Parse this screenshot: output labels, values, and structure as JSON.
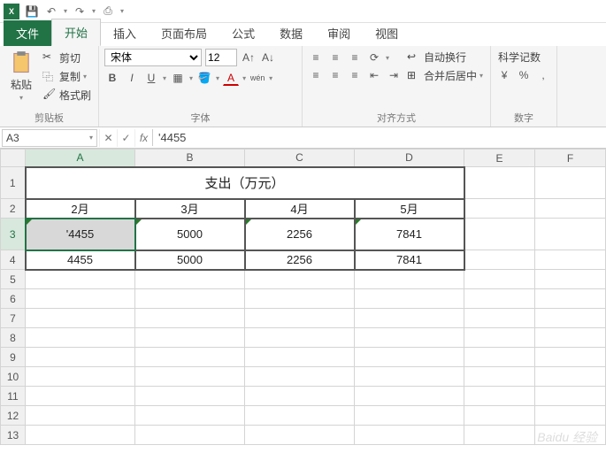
{
  "qat": {
    "excel": "X",
    "save": "💾",
    "undo": "↶",
    "redo": "↷",
    "print": "⎙"
  },
  "tabs": {
    "file": "文件",
    "home": "开始",
    "insert": "插入",
    "layout": "页面布局",
    "formula": "公式",
    "data": "数据",
    "review": "审阅",
    "view": "视图"
  },
  "clipboard": {
    "paste": "粘贴",
    "cut": "剪切",
    "copy": "复制",
    "format": "格式刷",
    "label": "剪贴板"
  },
  "font": {
    "name": "宋体",
    "size": "12",
    "bold": "B",
    "italic": "I",
    "underline": "U",
    "label": "字体",
    "wen": "wén"
  },
  "align": {
    "wrap": "自动换行",
    "merge": "合并后居中",
    "label": "对齐方式"
  },
  "number": {
    "sci": "科学记数",
    "pct": "%",
    "comma": ",",
    "label": "数字"
  },
  "namebox": "A3",
  "formula": "'4455",
  "cols": [
    "A",
    "B",
    "C",
    "D",
    "E",
    "F"
  ],
  "rows": [
    "1",
    "2",
    "3",
    "4",
    "5",
    "6",
    "7",
    "8",
    "9",
    "10",
    "11",
    "12",
    "13"
  ],
  "cells": {
    "title": "支出（万元）",
    "h": [
      "2月",
      "3月",
      "4月",
      "5月"
    ],
    "r3": [
      "'4455",
      "5000",
      "2256",
      "7841"
    ],
    "r4": [
      "4455",
      "5000",
      "2256",
      "7841"
    ]
  },
  "chart_data": {
    "type": "table",
    "title": "支出（万元）",
    "categories": [
      "2月",
      "3月",
      "4月",
      "5月"
    ],
    "series": [
      {
        "name": "row3",
        "values": [
          4455,
          5000,
          2256,
          7841
        ]
      },
      {
        "name": "row4",
        "values": [
          4455,
          5000,
          2256,
          7841
        ]
      }
    ]
  },
  "watermark": "Baidu 经验"
}
